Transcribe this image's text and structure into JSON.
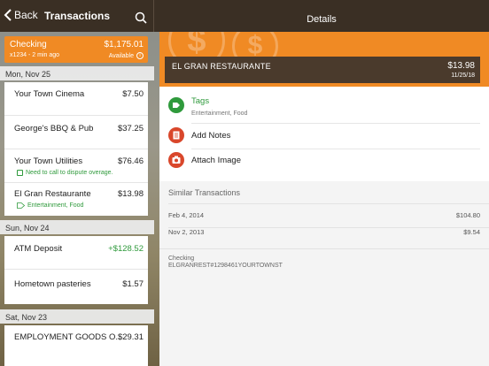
{
  "nav": {
    "back_label": "Back",
    "title": "Transactions",
    "details_title": "Details"
  },
  "account": {
    "name": "Checking",
    "balance": "$1,175.01",
    "subtitle": "x1234 - 2 min ago",
    "available_label": "Available"
  },
  "groups": [
    {
      "date": "Mon, Nov 25",
      "items": [
        {
          "name": "Your Town Cinema",
          "amount": "$7.50"
        },
        {
          "name": "George's BBQ & Pub",
          "amount": "$37.25"
        },
        {
          "name": "Your Town Utilities",
          "amount": "$76.46",
          "note": "Need to call to dispute overage."
        },
        {
          "name": "El Gran Restaurante",
          "amount": "$13.98",
          "tags": "Entertainment, Food"
        }
      ]
    },
    {
      "date": "Sun, Nov 24",
      "items": [
        {
          "name": "ATM Deposit",
          "amount": "+$128.52"
        },
        {
          "name": "Hometown pasteries",
          "amount": "$1.57"
        }
      ]
    },
    {
      "date": "Sat, Nov 23",
      "items": [
        {
          "name": "EMPLOYMENT GOODS O...",
          "amount": "$29.31"
        }
      ]
    }
  ],
  "detail": {
    "merchant": "EL GRAN RESTAURANTE",
    "amount": "$13.98",
    "date": "11/25/18",
    "tags_label": "Tags",
    "tags_value": "Entertainment, Food",
    "add_notes_label": "Add Notes",
    "attach_image_label": "Attach Image",
    "similar_title": "Similar Transactions",
    "similar": [
      {
        "date": "Feb 4, 2014",
        "amount": "$104.80"
      },
      {
        "date": "Nov 2, 2013",
        "amount": "$9.54"
      }
    ],
    "account_label": "Checking",
    "account_desc": "ELGRANREST#1298461YOURTOWNST"
  },
  "colors": {
    "accent": "#f08a24",
    "topbar": "#3a2f24",
    "positive": "#2f9a3c",
    "tags_green": "#2f9a3c",
    "notes_red": "#d9472b"
  },
  "icons": [
    "chevron-left-icon",
    "search-icon",
    "info-icon",
    "note-icon",
    "tag-icon",
    "notes-icon",
    "camera-icon"
  ]
}
